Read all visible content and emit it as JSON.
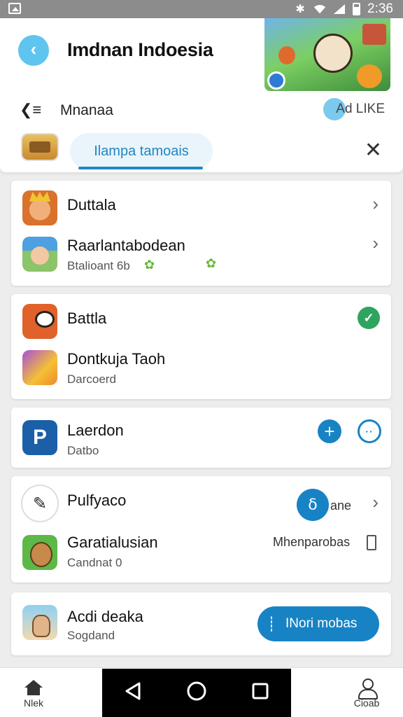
{
  "status_bar": {
    "time": "2:36"
  },
  "header": {
    "title": "Imdnan Indoesia",
    "back_icon": "arrow-left-icon",
    "banner": "game-banner-image"
  },
  "subnav": {
    "label": "Mnanaa",
    "right_label": "Ad LIKE",
    "tab_label": "Ilampa tamoais",
    "close_icon": "close-icon"
  },
  "cards": [
    {
      "rows": [
        {
          "title": "Duttala",
          "subtitle": "",
          "icon": "clash-king-app-icon",
          "trail": "chevron-right-icon"
        },
        {
          "title": "Raarlantabodean",
          "subtitle": "Btalioant 6b",
          "icon": "hero-app-icon",
          "trail": "chevron-right-icon"
        }
      ]
    },
    {
      "rows": [
        {
          "title": "Battla",
          "subtitle": "",
          "icon": "monster-app-icon",
          "trail": "check-icon"
        },
        {
          "title": "Dontkuja Taoh",
          "subtitle": "Darcoerd",
          "icon": "puzzle-app-icon",
          "trail": ""
        }
      ]
    },
    {
      "rows": [
        {
          "title": "Laerdon",
          "subtitle": "Datbo",
          "icon": "p-app-icon",
          "trail": "plus-icon"
        }
      ]
    },
    {
      "rows": [
        {
          "title": "Pulfyaco",
          "subtitle": "",
          "icon": "pen-app-icon",
          "trail_label": "ane",
          "trail": "chevron-right-icon"
        },
        {
          "title": "Garatialusian",
          "subtitle": "Candnat 0",
          "icon": "gara-app-icon",
          "trail_label": "Mhenparobas",
          "trail": ""
        }
      ]
    },
    {
      "rows": [
        {
          "title": "Acdi deaka",
          "subtitle": "Sogdand",
          "icon": "acdi-app-icon",
          "button_label": "INori mobas"
        }
      ]
    }
  ],
  "bottom_nav": {
    "left_label": "Nlek",
    "right_label": "Cioab"
  },
  "colors": {
    "accent": "#1883c4",
    "back_button": "#5fc4ee",
    "check_green": "#2ea55f",
    "status_bar": "#8c8c8c"
  }
}
